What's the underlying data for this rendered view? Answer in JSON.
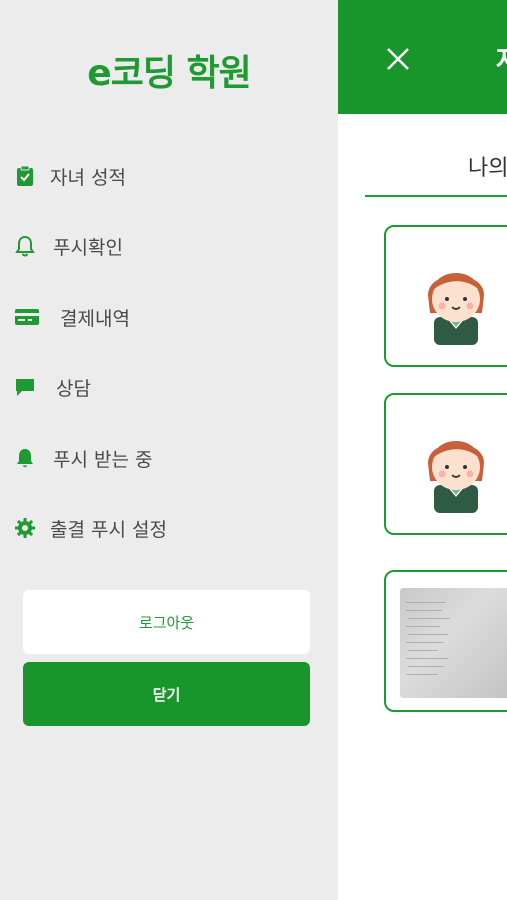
{
  "drawer": {
    "brand": "e코딩 학원",
    "items": [
      {
        "label": "자녀 성적",
        "icon": "clipboard-check-icon"
      },
      {
        "label": "푸시확인",
        "icon": "bell-outline-icon"
      },
      {
        "label": "결제내역",
        "icon": "credit-card-icon"
      },
      {
        "label": "상담",
        "icon": "chat-bubble-icon"
      },
      {
        "label": "푸시 받는 중",
        "icon": "bell-filled-icon"
      },
      {
        "label": "출결 푸시 설정",
        "icon": "gear-icon"
      }
    ],
    "logout_label": "로그아웃",
    "close_label": "닫기"
  },
  "main": {
    "header_title": "자",
    "close_icon": "close-icon",
    "tab_label": "나의",
    "cards": [
      {
        "type": "avatar"
      },
      {
        "type": "avatar"
      },
      {
        "type": "photo"
      }
    ]
  },
  "colors": {
    "brand_green": "#1f9a32",
    "header_green": "#18962c",
    "drawer_bg": "#ececec"
  }
}
